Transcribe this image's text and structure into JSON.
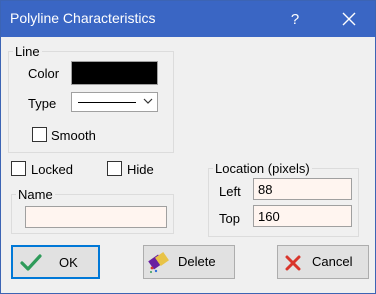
{
  "window": {
    "title": "Polyline Characteristics",
    "help_label": "?",
    "close_icon": "close-icon"
  },
  "line_group": {
    "legend": "Line",
    "color_label": "Color",
    "color_value": "#000000",
    "type_label": "Type",
    "type_value": "solid-line",
    "smooth_label": "Smooth",
    "smooth_checked": false
  },
  "locked": {
    "label": "Locked",
    "checked": false
  },
  "hide": {
    "label": "Hide",
    "checked": false
  },
  "name_group": {
    "legend": "Name",
    "value": ""
  },
  "location_group": {
    "legend": "Location (pixels)",
    "left_label": "Left",
    "left_value": "88",
    "top_label": "Top",
    "top_value": "160"
  },
  "buttons": {
    "ok": "OK",
    "delete": "Delete",
    "cancel": "Cancel"
  },
  "colors": {
    "title_bar": "#3a66c4",
    "ok_check": "#2f9b5a",
    "cancel_x": "#d9352b"
  }
}
